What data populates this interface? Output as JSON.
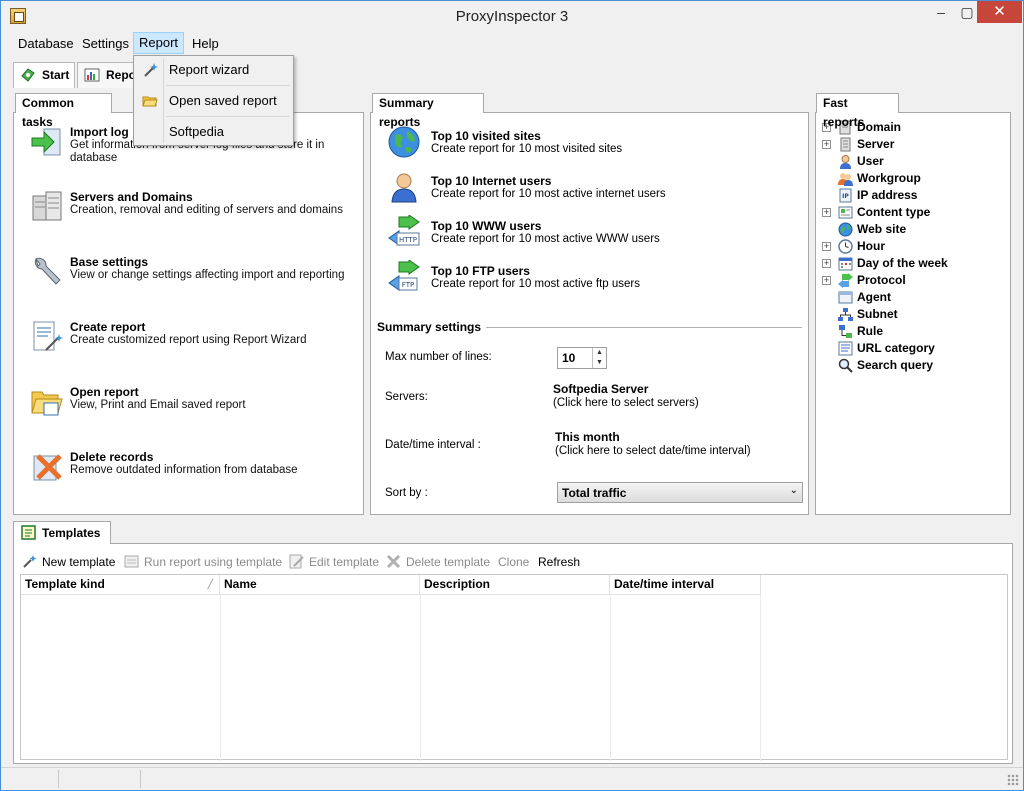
{
  "app": {
    "title": "ProxyInspector 3",
    "window_controls": {
      "minimize": "–",
      "maximize": "▢",
      "close": "✕"
    }
  },
  "menu": {
    "items": [
      {
        "label": "Database"
      },
      {
        "label": "Settings"
      },
      {
        "label": "Report"
      },
      {
        "label": "Help"
      }
    ]
  },
  "report_menu": {
    "items": [
      {
        "label": "Report wizard",
        "icon": "wand-icon"
      },
      {
        "label": "Open saved report",
        "icon": "folder-open-icon"
      },
      {
        "label": "Softpedia",
        "icon": ""
      }
    ]
  },
  "main_tabs": [
    {
      "label": "Start",
      "icon": "start-icon"
    },
    {
      "label": "Report",
      "icon": "report-chart-icon"
    }
  ],
  "common_tasks": {
    "title": "Common tasks",
    "items": [
      {
        "title": "Import log",
        "desc": "Get information from server log files and store it in database",
        "icon": "import-arrow-icon"
      },
      {
        "title": "Servers and Domains",
        "desc": "Creation, removal and editing of servers and domains",
        "icon": "servers-icon"
      },
      {
        "title": "Base settings",
        "desc": "View or change settings affecting import and reporting",
        "icon": "wrench-icon"
      },
      {
        "title": "Create report",
        "desc": "Create customized report using Report Wizard",
        "icon": "create-report-icon"
      },
      {
        "title": "Open report",
        "desc": "View, Print and Email saved report",
        "icon": "open-folder-icon"
      },
      {
        "title": "Delete records",
        "desc": "Remove outdated information from database",
        "icon": "delete-x-icon"
      }
    ]
  },
  "summary_reports": {
    "title": "Summary reports",
    "items": [
      {
        "title": "Top 10 visited sites",
        "desc": "Create report for  10 most visited sites",
        "icon": "globe-icon"
      },
      {
        "title": "Top 10 Internet users",
        "desc": "Create report for  10 most active internet users",
        "icon": "user-icon"
      },
      {
        "title": "Top 10 WWW users",
        "desc": "Create report for  10 most active WWW users",
        "icon": "http-icon",
        "icon_text": "HTTP"
      },
      {
        "title": "Top 10 FTP users",
        "desc": "Create report for  10 most active ftp users",
        "icon": "ftp-icon",
        "icon_text": "FTP"
      }
    ]
  },
  "summary_settings": {
    "title": "Summary settings",
    "max_lines_label": "Max number of lines:",
    "max_lines_value": "10",
    "servers_label": "Servers:",
    "servers_value": "Softpedia Server",
    "servers_hint": "(Click here to select servers)",
    "interval_label": "Date/time interval :",
    "interval_value": "This month",
    "interval_hint": "(Click here to select date/time interval)",
    "sort_label": "Sort by :",
    "sort_value": "Total traffic"
  },
  "fast_reports": {
    "title": "Fast reports",
    "items": [
      {
        "label": "Domain",
        "expandable": true,
        "icon": "domain-icon"
      },
      {
        "label": "Server",
        "expandable": true,
        "icon": "server-icon"
      },
      {
        "label": "User",
        "expandable": false,
        "icon": "user-icon"
      },
      {
        "label": "Workgroup",
        "expandable": false,
        "icon": "workgroup-icon"
      },
      {
        "label": "IP address",
        "expandable": false,
        "icon": "ip-address-icon"
      },
      {
        "label": "Content type",
        "expandable": true,
        "icon": "content-type-icon"
      },
      {
        "label": "Web site",
        "expandable": false,
        "icon": "web-site-icon"
      },
      {
        "label": "Hour",
        "expandable": true,
        "icon": "clock-icon"
      },
      {
        "label": "Day of the week",
        "expandable": true,
        "icon": "calendar-icon"
      },
      {
        "label": "Protocol",
        "expandable": true,
        "icon": "protocol-icon"
      },
      {
        "label": "Agent",
        "expandable": false,
        "icon": "agent-icon"
      },
      {
        "label": "Subnet",
        "expandable": false,
        "icon": "subnet-icon"
      },
      {
        "label": "Rule",
        "expandable": false,
        "icon": "rule-icon"
      },
      {
        "label": "URL category",
        "expandable": false,
        "icon": "url-category-icon"
      },
      {
        "label": "Search query",
        "expandable": false,
        "icon": "search-query-icon"
      }
    ]
  },
  "templates": {
    "title": "Templates",
    "toolbar": {
      "new": "New template",
      "run": "Run report using template",
      "edit": "Edit template",
      "delete": "Delete template",
      "clone": "Clone",
      "refresh": "Refresh"
    },
    "columns": [
      "Template kind",
      "Name",
      "Description",
      "Date/time interval"
    ]
  },
  "colors": {
    "accent": "#4a8fd6",
    "close_button": "#c7463c",
    "menu_highlight": "#cce8ff"
  }
}
